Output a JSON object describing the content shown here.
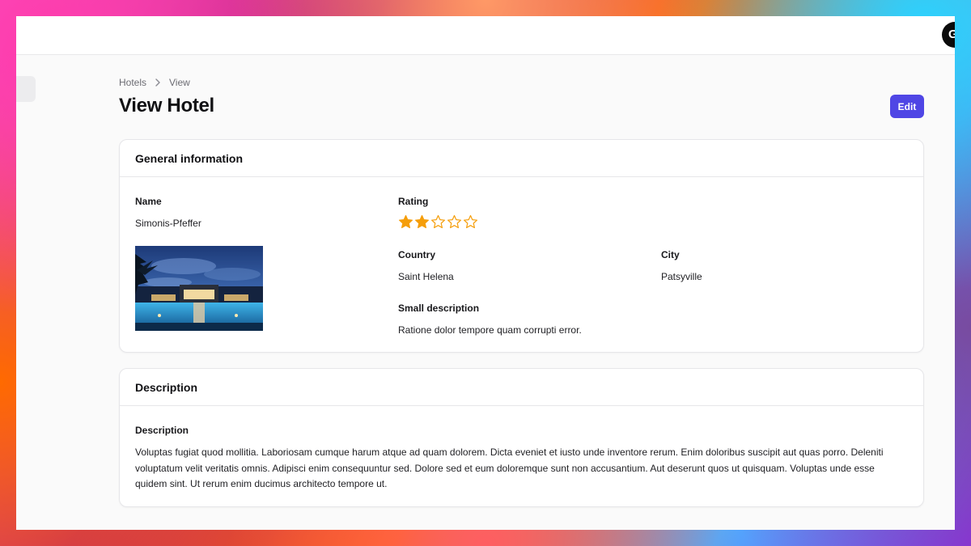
{
  "topbar": {
    "avatar_initial": "G"
  },
  "breadcrumb": {
    "items": [
      "Hotels",
      "View"
    ]
  },
  "page": {
    "title": "View Hotel",
    "edit_label": "Edit"
  },
  "general": {
    "header": "General information",
    "name_label": "Name",
    "name_value": "Simonis-Pfeffer",
    "rating_label": "Rating",
    "rating_value": 2,
    "rating_max": 5,
    "country_label": "Country",
    "country_value": "Saint Helena",
    "city_label": "City",
    "city_value": "Patsyville",
    "small_desc_label": "Small description",
    "small_desc_value": "Ratione dolor tempore quam corrupti error."
  },
  "description": {
    "header": "Description",
    "label": "Description",
    "text": "Voluptas fugiat quod mollitia. Laboriosam cumque harum atque ad quam dolorem. Dicta eveniet et iusto unde inventore rerum. Enim doloribus suscipit aut quas porro. Deleniti voluptatum velit veritatis omnis. Adipisci enim consequuntur sed. Dolore sed et eum doloremque sunt non accusantium. Aut deserunt quos ut quisquam. Voluptas unde esse quidem sint. Ut rerum enim ducimus architecto tempore ut."
  },
  "colors": {
    "accent": "#4f46e5",
    "star_filled": "#f59e0b",
    "star_empty_stroke": "#f59e0b"
  },
  "icons": {
    "breadcrumb_separator": "chevron-right-icon",
    "rating": "star-icon"
  }
}
